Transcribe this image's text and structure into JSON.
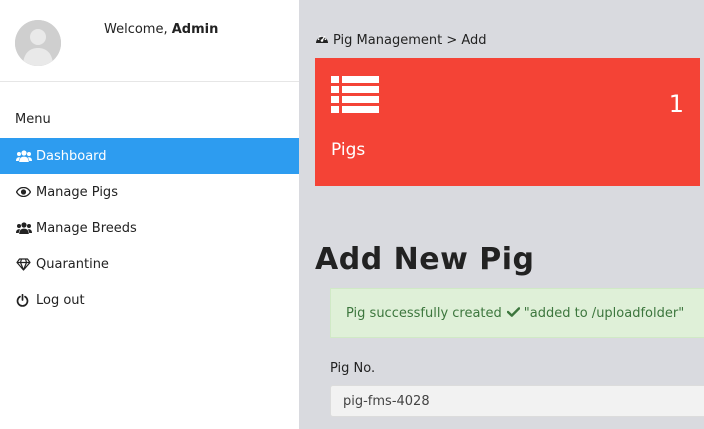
{
  "profile": {
    "welcome_prefix": "Welcome,",
    "username": "Admin"
  },
  "sidebar": {
    "menu_title": "Menu",
    "items": [
      {
        "label": "Dashboard",
        "icon": "users-icon",
        "active": true
      },
      {
        "label": "Manage Pigs",
        "icon": "eye-icon",
        "active": false
      },
      {
        "label": "Manage Breeds",
        "icon": "users-icon",
        "active": false
      },
      {
        "label": "Quarantine",
        "icon": "diamond-icon",
        "active": false
      },
      {
        "label": "Log out",
        "icon": "power-icon",
        "active": false
      }
    ]
  },
  "breadcrumb": {
    "icon": "dashboard-icon",
    "text": "Pig Management > Add"
  },
  "stat_card": {
    "icon": "list-icon",
    "count": "1",
    "label": "Pigs",
    "color": "#f44336"
  },
  "page": {
    "title": "Add New Pig"
  },
  "alert": {
    "message": "Pig successfully created",
    "icon": "check-icon",
    "detail": "\"added to /uploadfolder\"",
    "color": "#3c763d"
  },
  "form": {
    "pig_no_label": "Pig No.",
    "pig_no_value": "pig-fms-4028"
  },
  "colors": {
    "accent": "#2d9cf0",
    "background": "#d9dadf"
  }
}
